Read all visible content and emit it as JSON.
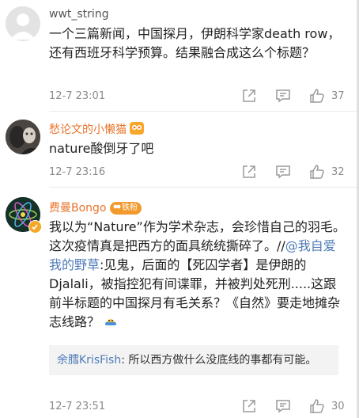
{
  "comments": [
    {
      "user": "wwt_string",
      "text": "一个三篇新闻，中国探月，伊朗科学家death row，还有西班牙科学预算。结果融合成这么个标题？",
      "time": "12-7 23:01",
      "likes": "37"
    },
    {
      "user": "愁论文的小懒猫",
      "text": "nature酸倒牙了吧",
      "time": "12-7 23:16",
      "likes": "32"
    },
    {
      "user": "费曼Bongo",
      "badge_text": "铁粉",
      "text_main": "我以为“Nature”作为学术杂志，会珍惜自己的羽毛。这次疫情真是把西方的面具统统撕碎了。//",
      "mention": "@我自爱我的野草",
      "text_rest": ":见鬼，后面的【死囚学者】是伊朗的Djalali，被指控犯有间谍罪，并被判处死刑.....这跟前半标题的中国探月有毛关系？《自然》要走地摊杂志线路？",
      "reply_user": "余膤KrisFish",
      "reply_text": ": 所以西方做什么没底线的事都有可能。",
      "time": "12-7 23:51",
      "likes": "30"
    }
  ],
  "colors": {
    "link": "#4f7bb8",
    "vip_name": "#e8742b",
    "meta": "#8a8a8a"
  },
  "icons": [
    "share-icon",
    "comment-icon",
    "like-icon",
    "emoji-icon",
    "vip-badge-icon"
  ]
}
